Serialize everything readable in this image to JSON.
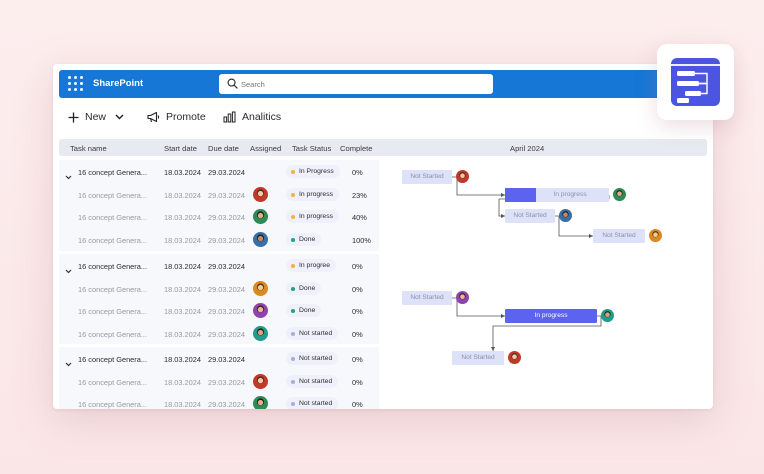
{
  "app": {
    "name": "SharePoint"
  },
  "search": {
    "placeholder": "Search"
  },
  "toolbar": {
    "new_label": "New",
    "promote_label": "Promote",
    "analytics_label": "Analitics"
  },
  "table": {
    "headers": [
      "Task name",
      "Start date",
      "Due date",
      "Assigned",
      "Task Status",
      "Complete"
    ],
    "gantt_header": "April 2024",
    "groups": [
      {
        "parent": {
          "name": "16 concept Genera...",
          "start": "18.03.2024",
          "due": "29.03.2024",
          "status": "In Progress",
          "complete": "0%"
        },
        "children": [
          {
            "name": "16 concept Genera...",
            "start": "18.03.2024",
            "due": "29.03.2024",
            "status": "In progress",
            "complete": "23%"
          },
          {
            "name": "16 concept Genera...",
            "start": "18.03.2024",
            "due": "29.03.2024",
            "status": "In progress",
            "complete": "40%"
          },
          {
            "name": "16 concept Genera...",
            "start": "18.03.2024",
            "due": "29.03.2024",
            "status": "Done",
            "complete": "100%"
          }
        ]
      },
      {
        "parent": {
          "name": "16 concept Genera...",
          "start": "18.03.2024",
          "due": "29.03.2024",
          "status": "In progree",
          "complete": "0%"
        },
        "children": [
          {
            "name": "16 concept Genera...",
            "start": "18.03.2024",
            "due": "29.03.2024",
            "status": "Done",
            "complete": "0%"
          },
          {
            "name": "16 concept Genera...",
            "start": "18.03.2024",
            "due": "29.03.2024",
            "status": "Done",
            "complete": "0%"
          },
          {
            "name": "16 concept Genera...",
            "start": "18.03.2024",
            "due": "29.03.2024",
            "status": "Not started",
            "complete": "0%"
          }
        ]
      },
      {
        "parent": {
          "name": "16 concept Genera...",
          "start": "18.03.2024",
          "due": "29.03.2024",
          "status": "Not started",
          "complete": "0%"
        },
        "children": [
          {
            "name": "16 concept Genera...",
            "start": "18.03.2024",
            "due": "29.03.2024",
            "status": "Not started",
            "complete": "0%"
          },
          {
            "name": "16 concept Genera...",
            "start": "18.03.2024",
            "due": "29.03.2024",
            "status": "Not started",
            "complete": "0%"
          }
        ]
      }
    ]
  },
  "gantt": {
    "bars": [
      {
        "label": "Not Started"
      },
      {
        "label": "In progress"
      },
      {
        "label": "Not Started"
      },
      {
        "label": "Not Started"
      },
      {
        "label": "Not Started"
      },
      {
        "label": "In progress"
      },
      {
        "label": "Not Started"
      }
    ]
  },
  "colors": {
    "appbar": "#1677d6",
    "status_in_progress": "#f5b041",
    "status_done": "#1fa37a",
    "status_not_started": "#a9aed8",
    "gantt_active": "#5b63f0",
    "gantt_pending": "#dde2f8"
  },
  "icons": {
    "waffle": "app-launcher-icon",
    "search": "search-icon",
    "new": "plus-icon",
    "dropdown": "chevron-down-icon",
    "promote": "megaphone-icon",
    "analytics": "bar-chart-icon",
    "logo": "gantt-logo-icon"
  }
}
